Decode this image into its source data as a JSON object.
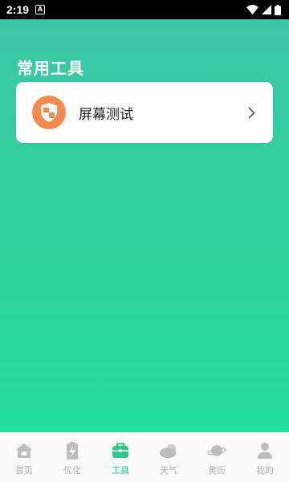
{
  "status_bar": {
    "time": "2:19",
    "notification_icon_letter": "A"
  },
  "section": {
    "title": "常用工具"
  },
  "tools": [
    {
      "label": "屏幕测试",
      "icon": "shield-icon",
      "icon_color": "#f5894e"
    }
  ],
  "tab_bar": {
    "active_color": "#2fc98d",
    "inactive_color": "#b4b4b4",
    "tabs": [
      {
        "label": "首页",
        "icon": "home-icon",
        "active": false
      },
      {
        "label": "优化",
        "icon": "battery-bolt-icon",
        "active": false
      },
      {
        "label": "工具",
        "icon": "toolbox-icon",
        "active": true
      },
      {
        "label": "天气",
        "icon": "cloud-icon",
        "active": false
      },
      {
        "label": "黄历",
        "icon": "planet-icon",
        "active": false
      },
      {
        "label": "我的",
        "icon": "user-icon",
        "active": false
      }
    ]
  },
  "colors": {
    "gradient_top": "#3cc6a6",
    "gradient_bottom": "#20e19a"
  }
}
